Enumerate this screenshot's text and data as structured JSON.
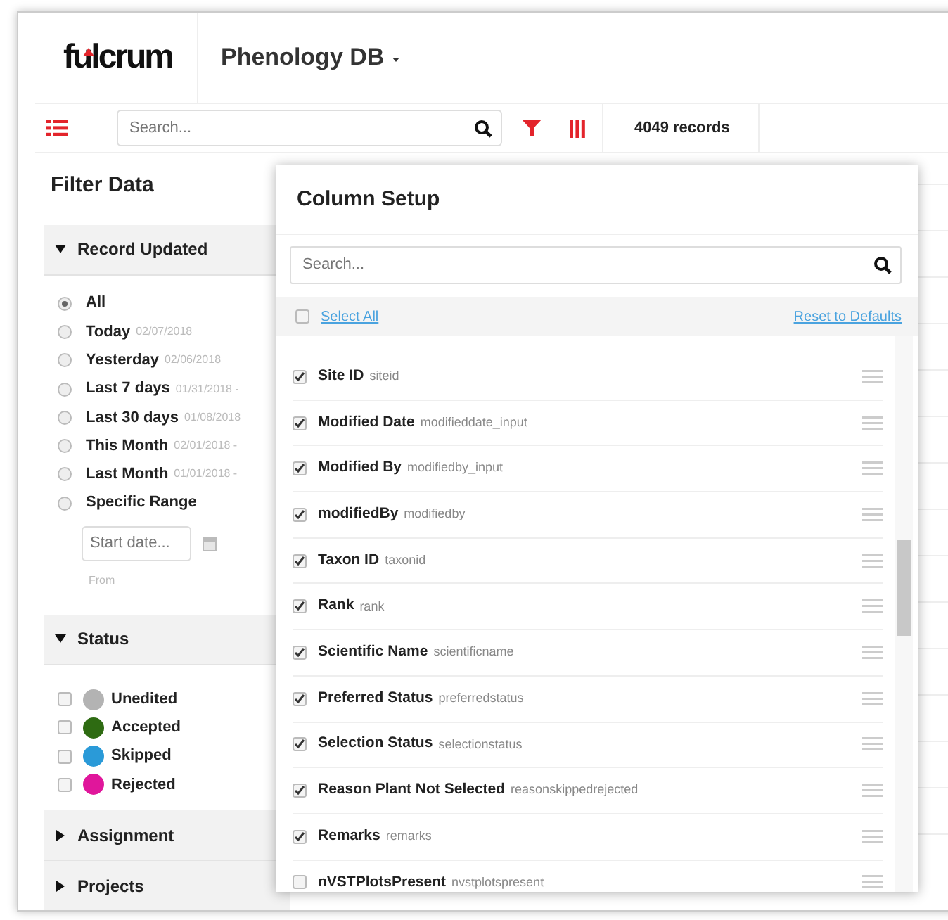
{
  "header": {
    "logo": "fulcrum",
    "app_title": "Phenology DB"
  },
  "toolbar": {
    "search": {
      "placeholder": "Search..."
    },
    "record_count": "4049 records"
  },
  "filter": {
    "title": "Filter Data",
    "record_updated": {
      "title": "Record Updated",
      "expanded": true,
      "options": [
        {
          "label": "All",
          "selected": true
        },
        {
          "label": "Today",
          "date": "02/07/2018",
          "selected": false
        },
        {
          "label": "Yesterday",
          "date": "02/06/2018",
          "selected": false
        },
        {
          "label": "Last 7 days",
          "date": "01/31/2018 -",
          "selected": false
        },
        {
          "label": "Last 30 days",
          "date": "01/08/2018",
          "selected": false
        },
        {
          "label": "This Month",
          "date": "02/01/2018 -",
          "selected": false
        },
        {
          "label": "Last Month",
          "date": "01/01/2018 -",
          "selected": false
        },
        {
          "label": "Specific Range",
          "selected": false
        }
      ],
      "start_date": {
        "placeholder": "Start date...",
        "caption": "From"
      }
    },
    "status": {
      "title": "Status",
      "expanded": true,
      "items": [
        {
          "label": "Unedited",
          "color": "#b3b3b3",
          "checked": false
        },
        {
          "label": "Accepted",
          "color": "#2e6b12",
          "checked": false
        },
        {
          "label": "Skipped",
          "color": "#2a9ad8",
          "checked": false
        },
        {
          "label": "Rejected",
          "color": "#e0169b",
          "checked": false
        }
      ]
    },
    "collapsed_sections": [
      {
        "title": "Assignment",
        "expanded": false
      },
      {
        "title": "Projects",
        "expanded": false
      }
    ]
  },
  "column_setup": {
    "title": "Column Setup",
    "search": {
      "placeholder": "Search..."
    },
    "select_all": {
      "label": "Select All",
      "checked": false
    },
    "reset": "Reset to Defaults",
    "columns": [
      {
        "label": "Site ID",
        "field": "siteid",
        "checked": true
      },
      {
        "label": "Modified Date",
        "field": "modifieddate_input",
        "checked": true
      },
      {
        "label": "Modified By",
        "field": "modifiedby_input",
        "checked": true
      },
      {
        "label": "modifiedBy",
        "field": "modifiedby",
        "checked": true
      },
      {
        "label": "Taxon ID",
        "field": "taxonid",
        "checked": true
      },
      {
        "label": "Rank",
        "field": "rank",
        "checked": true
      },
      {
        "label": "Scientific Name",
        "field": "scientificname",
        "checked": true
      },
      {
        "label": "Preferred Status",
        "field": "preferredstatus",
        "checked": true
      },
      {
        "label": "Selection Status",
        "field": "selectionstatus",
        "checked": true
      },
      {
        "label": "Reason Plant Not Selected",
        "field": "reasonskippedrejected",
        "checked": true
      },
      {
        "label": "Remarks",
        "field": "remarks",
        "checked": true
      },
      {
        "label": "nVSTPlotsPresent",
        "field": "nvstplotspresent",
        "checked": false
      }
    ]
  }
}
